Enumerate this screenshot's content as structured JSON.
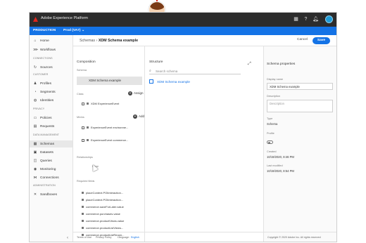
{
  "topbar": {
    "app_title": "Adobe Experience Platform"
  },
  "subbar": {
    "org": "PRODUCTION",
    "sandbox": "Prod (VA7)"
  },
  "nav": {
    "items": [
      {
        "label": "Home",
        "icon": "home-icon"
      },
      {
        "label": "Workflows",
        "icon": "workflow-icon"
      },
      {
        "section": "CONNECTIONS"
      },
      {
        "label": "Sources",
        "icon": "source-icon"
      },
      {
        "section": "CUSTOMER"
      },
      {
        "label": "Profiles",
        "icon": "profile-icon"
      },
      {
        "label": "Segments",
        "icon": "segment-icon"
      },
      {
        "label": "Identities",
        "icon": "identity-icon"
      },
      {
        "section": "PRIVACY"
      },
      {
        "label": "Policies",
        "icon": "policy-icon"
      },
      {
        "label": "Requests",
        "icon": "request-icon"
      },
      {
        "section": "DATA MANAGEMENT"
      },
      {
        "label": "Schemas",
        "icon": "schema-icon",
        "active": true
      },
      {
        "label": "Datasets",
        "icon": "dataset-icon"
      },
      {
        "label": "Queries",
        "icon": "query-icon"
      },
      {
        "label": "Monitoring",
        "icon": "monitoring-icon"
      },
      {
        "label": "Connections",
        "icon": "connection-icon"
      },
      {
        "section": "ADMINISTRATION"
      },
      {
        "label": "Sandboxes",
        "icon": "sandbox-icon"
      }
    ]
  },
  "header": {
    "crumb_parent": "Schemas",
    "crumb_current": "XDM Schema example",
    "cancel": "Cancel",
    "save": "Save"
  },
  "composition": {
    "title": "Composition",
    "schema_label": "Schema",
    "schema_name": "XDM Schema example",
    "class_label": "Class",
    "assign": "Assign",
    "class_item": "XDM ExperienceEvent",
    "mixins_label": "Mixins",
    "add": "Add",
    "mixins": [
      "ExperienceEvent environme...",
      "ExperienceEvent commerce..."
    ],
    "relation_label": "Relationships",
    "relation_value": "None",
    "required_label": "Required fields",
    "required": [
      "placeContext.POIinteraction...",
      "placeContext.POIinteraction...",
      "commerce.saveForLater.value",
      "commerce.purchases.value",
      "commerce.productViews.value",
      "commerce.productListViews...",
      "commerce.productListReopn..."
    ]
  },
  "structure": {
    "title": "Structure",
    "search_placeholder": "Search schema",
    "root": "XDM Schema example"
  },
  "properties": {
    "title": "Schema properties",
    "display_name_label": "Display name",
    "display_name_value": "XDM Schema example",
    "description_label": "Description",
    "description_placeholder": "Description",
    "type_label": "Type",
    "type_value": "Schema",
    "profile_label": "Profile",
    "created_label": "Created",
    "created_value": "10/19/2020, 8:46 PM",
    "modified_label": "Last modified",
    "modified_value": "10/19/2020, 8:54 PM"
  },
  "footer": {
    "terms": "Terms of Use",
    "privacy": "Privacy Policy",
    "language_label": "Language:",
    "language": "English",
    "copyright": "Copyright © 2020 Adobe Inc. All rights reserved"
  },
  "colors": {
    "accent": "#1473e6",
    "topbar": "#2c2c2c"
  }
}
